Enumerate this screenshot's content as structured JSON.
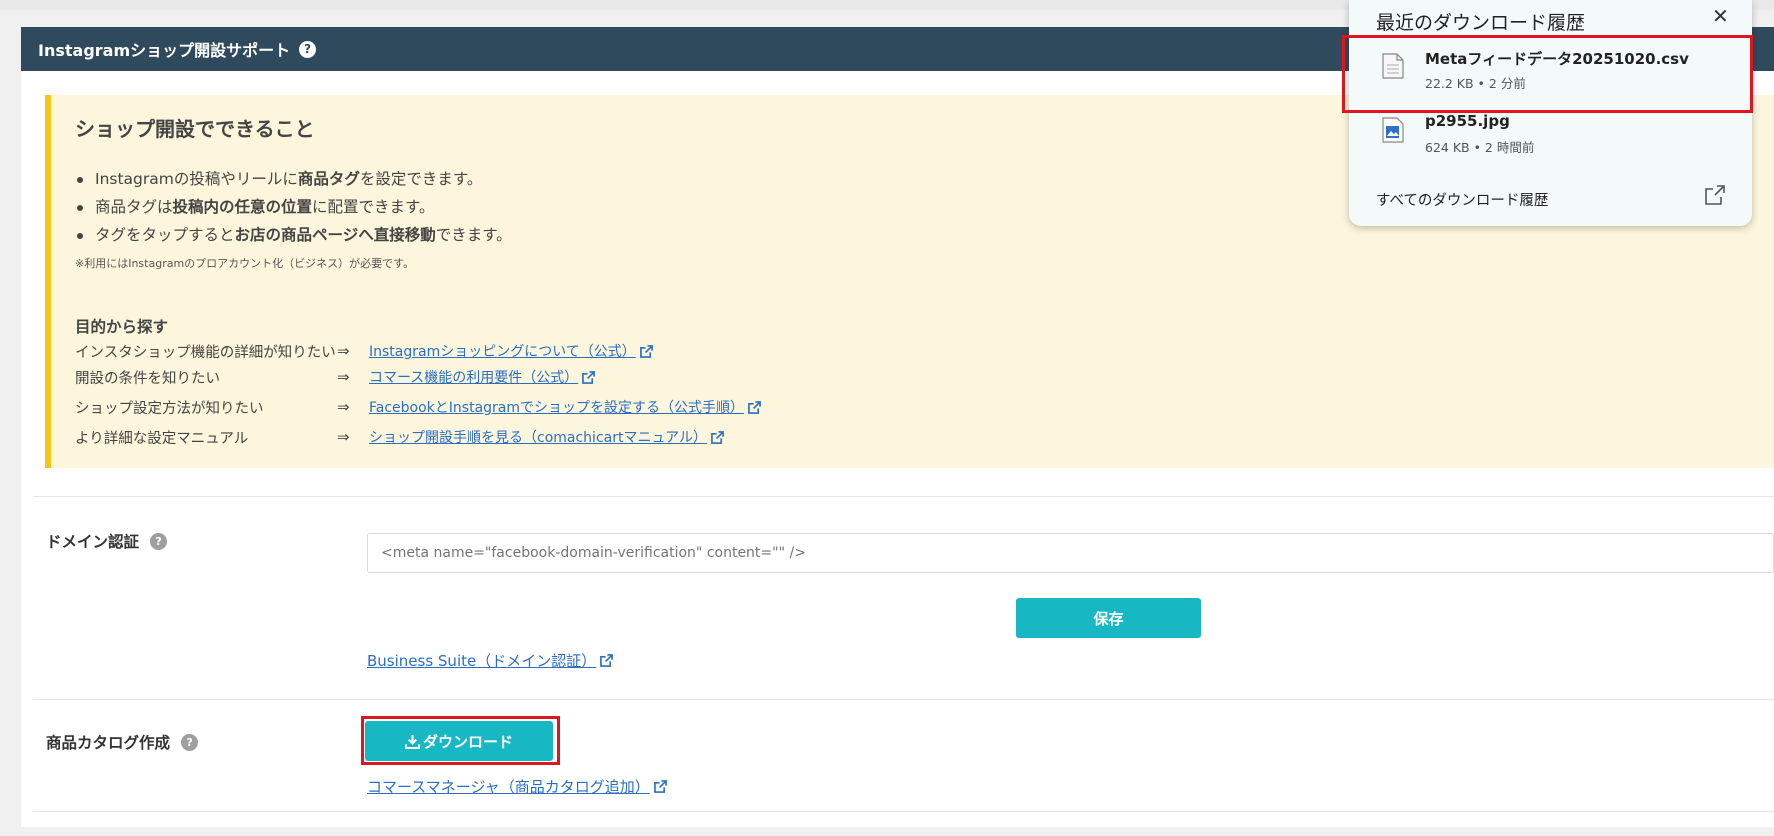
{
  "header": {
    "title": "Instagramショップ開設サポート",
    "help": "?"
  },
  "info": {
    "title": "ショップ開設でできること",
    "bullets": [
      [
        "Instagramの投稿やリールに",
        "商品タグ",
        "を設定できます。"
      ],
      [
        "商品タグは",
        "投稿内の任意の位置",
        "に配置できます。"
      ],
      [
        "タグをタップすると",
        "お店の商品ページへ直接移動",
        "できます。"
      ]
    ],
    "note": "※利用にはInstagramのプロアカウント化（ビジネス）が必要です。",
    "purpose_title": "目的から探す",
    "arrow": "⇒",
    "purposes": [
      {
        "label": "インスタショップ機能の詳細が知りたい",
        "link": "Instagramショッピングについて（公式）"
      },
      {
        "label": "開設の条件を知りたい",
        "link": "コマース機能の利用要件（公式）"
      },
      {
        "label": "ショップ設定方法が知りたい",
        "link": "FacebookとInstagramでショップを設定する（公式手順）"
      },
      {
        "label": "より詳細な設定マニュアル",
        "link": "ショップ開設手順を見る（comachicartマニュアル）"
      }
    ]
  },
  "domain": {
    "label": "ドメイン認証",
    "help": "?",
    "placeholder": "<meta name=\"facebook-domain-verification\" content=\"\" />",
    "save": "保存",
    "link": "Business Suite（ドメイン認証）"
  },
  "catalog": {
    "label": "商品カタログ作成",
    "help": "?",
    "download": "ダウンロード",
    "link": "コマースマネージャ（商品カタログ追加）"
  },
  "downloads": {
    "title": "最近のダウンロード履歴",
    "close": "✕",
    "items": [
      {
        "name": "Metaフィードデータ20251020.csv",
        "meta": "22.2 KB • 2 分前",
        "icon": "file-icon"
      },
      {
        "name": "p2955.jpg",
        "meta": "624 KB • 2 時間前",
        "icon": "image-file-icon"
      }
    ],
    "all": "すべてのダウンロード履歴"
  },
  "colors": {
    "header": "#2f4a5c",
    "accent": "#17b8c3",
    "info_bg": "#fdf6dc",
    "info_border": "#f5c518",
    "highlight": "#e0161e",
    "link": "#2a6fc4"
  }
}
